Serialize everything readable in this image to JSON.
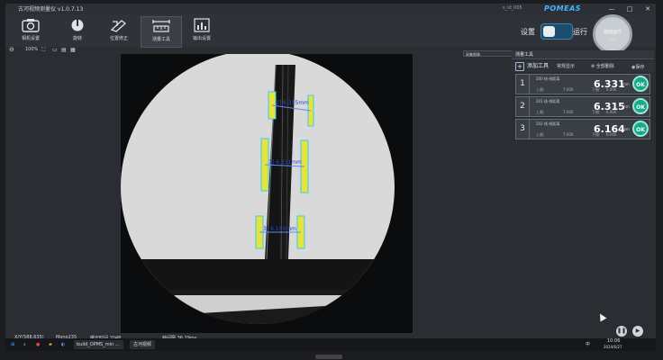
{
  "window": {
    "title": "古河视频测量仪 v1.0.7.13",
    "center_text": "s_id_005",
    "brand": "POMEAS",
    "controls": [
      "—",
      "□",
      "✕"
    ]
  },
  "toolbar": {
    "tools": [
      {
        "label": "相机设置",
        "icon": "camera-icon"
      },
      {
        "label": "旋转",
        "icon": "rotate-icon"
      },
      {
        "label": "位置修正",
        "icon": "position-correct-icon"
      },
      {
        "label": "测量工具",
        "icon": "measure-tool-icon"
      },
      {
        "label": "输出设置",
        "icon": "output-chart-icon"
      }
    ],
    "settings_label": "设置",
    "run_label": "运行",
    "run_circle_line1": "自动运行",
    "run_circle_line2": "—"
  },
  "zoom": {
    "level": "100%"
  },
  "mode_select": {
    "value": "采集图像"
  },
  "panel": {
    "title": "测量工具",
    "add_tool_label": "添加工具",
    "display_mode_label": "常规显示",
    "delete_all_label": "全部删除",
    "save_label": "保存"
  },
  "measurements": [
    {
      "index": "1",
      "name": "200 线-线距离",
      "value": "6.331",
      "unit": "mm",
      "upper_label": "上限:",
      "upper": "7.000",
      "lower_label": "下限:",
      "lower": "6.000",
      "status": "OK"
    },
    {
      "index": "2",
      "name": "201 线-线距离",
      "value": "6.315",
      "unit": "mm",
      "upper_label": "上限:",
      "upper": "7.000",
      "lower_label": "下限:",
      "lower": "6.000",
      "status": "OK"
    },
    {
      "index": "3",
      "name": "202 线-线距离",
      "value": "6.164",
      "unit": "mm",
      "upper_label": "上限:",
      "upper": "7.000",
      "lower_label": "下限:",
      "lower": "6.000",
      "status": "OK"
    }
  ],
  "overlay_labels": [
    "2] 6.315mm",
    "1] 6.331mm",
    "3] 6.164mm"
  ],
  "statusbar": {
    "coords": "X/Y(588,635)",
    "camera": "Mono235",
    "exposure": "曝光时间 2048",
    "fps": "帧间隔 36.29ms"
  },
  "taskbar": {
    "items": [
      "build_OPMS_min ...",
      "古河视频"
    ],
    "time": "10:06",
    "date": "2024/6/27",
    "lang": "中"
  },
  "colors": {
    "accent": "#49b3ff",
    "ok": "#16a98a",
    "overlay_line": "#5b8cff",
    "edge_box": "#2fd0ff",
    "edge_fill": "#e8e23a"
  }
}
